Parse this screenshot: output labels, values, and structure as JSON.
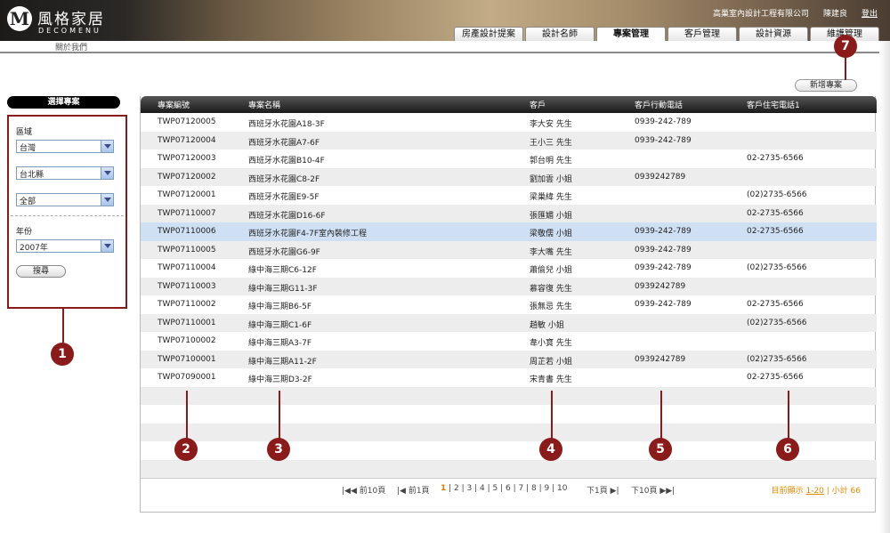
{
  "brand": {
    "logo_mark": "M",
    "name_cn": "風格家居",
    "name_en": "DECOMENU"
  },
  "top_bar": {
    "company": "高巢室內設計工程有限公司",
    "user": "陳建良",
    "logout": "登出"
  },
  "tabs": [
    "房產設計提案",
    "設計名師",
    "專案管理",
    "客戶管理",
    "設計資源",
    "維護管理"
  ],
  "active_tab": "專案管理",
  "sub_link": "關於我們",
  "sidebar": {
    "title": "選擇專案",
    "region_label": "區域",
    "region_value": "台灣",
    "city_value": "台北縣",
    "district_value": "全部",
    "year_label": "年份",
    "year_value": "2007年",
    "search_button": "搜尋"
  },
  "new_project_button": "新增專案",
  "table": {
    "columns": [
      "專案編號",
      "專案名稱",
      "客戶",
      "客戶行動電話",
      "客戶住宅電話1"
    ],
    "rows": [
      [
        "TWP07120005",
        "西班牙水花園A18-3F",
        "李大安 先生",
        "0939-242-789",
        ""
      ],
      [
        "TWP07120004",
        "西班牙水花園A7-6F",
        "王小三 先生",
        "0939-242-789",
        ""
      ],
      [
        "TWP07120003",
        "西班牙水花園B10-4F",
        "郭台明 先生",
        "",
        "02-2735-6566"
      ],
      [
        "TWP07120002",
        "西班牙水花園C8-2F",
        "劉加雲 小姐",
        "0939242789",
        ""
      ],
      [
        "TWP07120001",
        "西班牙水花園E9-5F",
        "梁巢緯 先生",
        "",
        "(02)2735-6566"
      ],
      [
        "TWP07110007",
        "西班牙水花園D16-6F",
        "張匯媚 小姐",
        "",
        "02-2735-6566"
      ],
      [
        "TWP07110006",
        "西班牙水花園F4-7F室內裝修工程",
        "梁敬儒 小姐",
        "0939-242-789",
        "02-2735-6566"
      ],
      [
        "TWP07110005",
        "西班牙水花園G6-9F",
        "李大嘴 先生",
        "0939-242-789",
        ""
      ],
      [
        "TWP07110004",
        "綠中海三期C6-12F",
        "蕭偷兒 小姐",
        "0939-242-789",
        "(02)2735-6566"
      ],
      [
        "TWP07110003",
        "綠中海三期G11-3F",
        "慕容復 先生",
        "0939242789",
        ""
      ],
      [
        "TWP07110002",
        "綠中海三期B6-5F",
        "張無忌 先生",
        "0939-242-789",
        "02-2735-6566"
      ],
      [
        "TWP07110001",
        "綠中海三期C1-6F",
        "趙敏 小姐",
        "",
        "(02)2735-6566"
      ],
      [
        "TWP07100002",
        "綠中海三期A3-7F",
        "韋小寶 先生",
        "",
        ""
      ],
      [
        "TWP07100001",
        "綠中海三期A11-2F",
        "周芷若 小姐",
        "0939242789",
        "(02)2735-6566"
      ],
      [
        "TWP07090001",
        "綠中海三期D3-2F",
        "宋青書 先生",
        "",
        "02-2735-6566"
      ],
      [
        "",
        "",
        "",
        "",
        ""
      ],
      [
        "",
        "",
        "",
        "",
        ""
      ],
      [
        "",
        "",
        "",
        "",
        ""
      ],
      [
        "",
        "",
        "",
        "",
        ""
      ],
      [
        "",
        "",
        "",
        "",
        ""
      ]
    ],
    "selected_row": 6
  },
  "pager": {
    "prev10": "前10頁",
    "prev1": "前1頁",
    "pages": [
      "1",
      "2",
      "3",
      "4",
      "5",
      "6",
      "7",
      "8",
      "9",
      "10"
    ],
    "current": "1",
    "next1": "下1頁",
    "next10": "下10頁",
    "summary_prefix": "目前顯示",
    "summary_range": "1-20",
    "summary_total": "小計 66"
  },
  "markers": [
    "1",
    "2",
    "3",
    "4",
    "5",
    "6",
    "7"
  ],
  "colors": {
    "accent": "#8b1a1a",
    "selected_row": "#cfe0f5",
    "pager_current": "#e07a00"
  }
}
